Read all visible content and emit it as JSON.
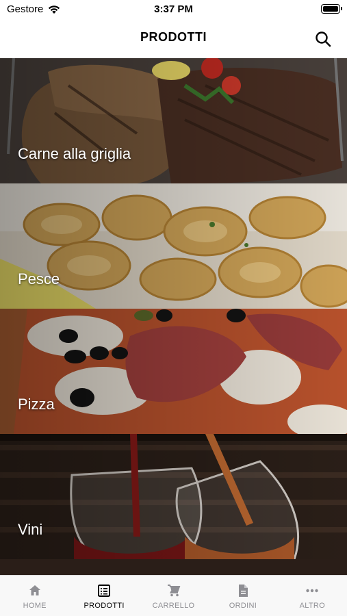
{
  "status_bar": {
    "carrier": "Gestore",
    "time": "3:37 PM"
  },
  "nav": {
    "title": "PRODOTTI",
    "search_icon": "search-icon"
  },
  "categories": [
    {
      "label": "Carne alla griglia"
    },
    {
      "label": "Pesce"
    },
    {
      "label": "Pizza"
    },
    {
      "label": "Vini"
    }
  ],
  "tabs": [
    {
      "label": "HOME",
      "icon": "home-icon",
      "active": false
    },
    {
      "label": "PRODOTTI",
      "icon": "products-icon",
      "active": true
    },
    {
      "label": "CARRELLO",
      "icon": "cart-icon",
      "active": false
    },
    {
      "label": "ORDINI",
      "icon": "document-icon",
      "active": false
    },
    {
      "label": "ALTRO",
      "icon": "more-icon",
      "active": false
    }
  ]
}
